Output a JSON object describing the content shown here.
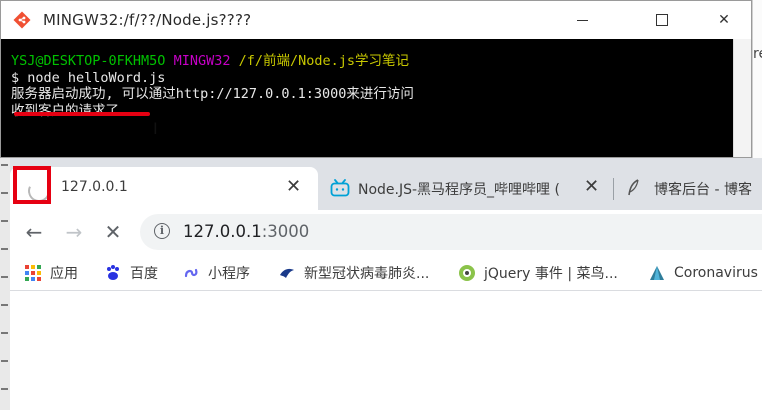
{
  "terminal": {
    "title": "MINGW32:/f/??/Node.js????",
    "prompt_user": "YSJ@DESKTOP-0FKHM5O",
    "prompt_env": "MINGW32",
    "prompt_path": "/f/前端/Node.js学习笔记",
    "command": "$ node helloWord.js",
    "output_1": "服务器启动成功, 可以通过http://127.0.0.1:3000来进行访问",
    "output_2": "收到客户的请求了",
    "window_controls": {
      "minimize": "—",
      "maximize": "☐",
      "close": "✕"
    }
  },
  "background_window": {
    "partial_text": "re"
  },
  "browser": {
    "tabs": [
      {
        "label": "127.0.0.1",
        "loading": true,
        "close": "✕"
      },
      {
        "label": "Node.JS-黑马程序员_哔哩哔哩 (",
        "icon": "bilibili-icon",
        "close": "✕"
      },
      {
        "label": "博客后台 - 博客",
        "icon": "feather-icon"
      }
    ],
    "nav": {
      "back": "←",
      "forward": "→",
      "stop": "✕"
    },
    "address": {
      "host": "127.0.0.1",
      "port": ":3000",
      "info_icon": "i"
    },
    "bookmarks": [
      {
        "label": "应用",
        "icon": "apps-grid-icon"
      },
      {
        "label": "百度",
        "icon": "baidu-paw-icon"
      },
      {
        "label": "小程序",
        "icon": "mini-program-icon"
      },
      {
        "label": "新型冠状病毒肺炎...",
        "icon": "bird-icon"
      },
      {
        "label": "jQuery 事件 | 菜鸟...",
        "icon": "runoob-icon"
      },
      {
        "label": "Coronavirus",
        "icon": "triangle-icon"
      }
    ]
  },
  "colors": {
    "annotation_red": "#e60012",
    "prompt_green": "#00c200",
    "prompt_magenta": "#c600c6",
    "prompt_yellow": "#c8c800"
  }
}
